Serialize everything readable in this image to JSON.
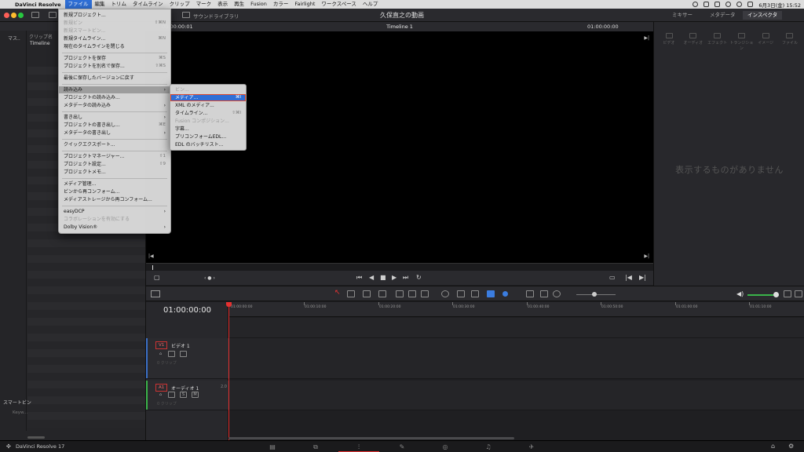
{
  "menubar": {
    "app_name": "DaVinci Resolve",
    "menus": [
      "ファイル",
      "編集",
      "トリム",
      "タイムライン",
      "クリップ",
      "マーク",
      "表示",
      "再生",
      "Fusion",
      "カラー",
      "Fairlight",
      "ワークスペース",
      "ヘルプ"
    ],
    "active_menu": "ファイル",
    "clock": "6月3日(金)  15:52"
  },
  "header": {
    "project_title": "久保直之の動画",
    "sound_library": "サウンドライブラリ",
    "right_tabs": [
      "ミキサー",
      "メタデータ",
      "インスペクタ"
    ],
    "active_right_tab": "インスペクタ"
  },
  "media_pool": {
    "master_label": "マス..",
    "clip_label": "クリップ名",
    "timeline_item": "Timeline",
    "smart_bins": "スマートビン",
    "keywords": "Keyw..."
  },
  "viewer": {
    "timecode_left": "00:00:00:01",
    "timeline_name": "Timeline 1",
    "timecode_right": "01:00:00:00"
  },
  "inspector": {
    "tabs": [
      "ビデオ",
      "オーディオ",
      "エフェクト",
      "トランジション",
      "イメージ",
      "ファイル"
    ],
    "empty_message": "表示するものがありません"
  },
  "timeline": {
    "current_timecode": "01:00:00:00",
    "ruler_ticks": [
      "01:00:00:00",
      "01:00:10:00",
      "01:00:20:00",
      "01:00:30:00",
      "01:00:40:00",
      "01:00:50:00",
      "01:01:00:00",
      "01:01:10:00"
    ],
    "tracks": [
      {
        "id": "V1",
        "name": "ビデオ 1",
        "info": "0 クリップ",
        "kind": "video"
      },
      {
        "id": "A1",
        "name": "オーディオ 1",
        "info": "0 クリップ",
        "volume": "2.0",
        "kind": "audio"
      }
    ]
  },
  "file_menu": {
    "items": [
      {
        "label": "新規プロジェクト...",
        "shortcut": "",
        "disabled": false
      },
      {
        "label": "新規ビン",
        "shortcut": "⇧⌘N",
        "disabled": true
      },
      {
        "label": "新規スマートビン...",
        "shortcut": "",
        "disabled": true
      },
      {
        "label": "新規タイムライン...",
        "shortcut": "⌘N",
        "disabled": false
      },
      {
        "label": "現在のタイムラインを閉じる",
        "shortcut": "",
        "disabled": false
      },
      {
        "label": "プロジェクトを保存",
        "shortcut": "⌘S",
        "disabled": false
      },
      {
        "label": "プロジェクトを別名で保存...",
        "shortcut": "⇧⌘S",
        "disabled": false
      },
      {
        "label": "最後に保存したバージョンに戻す",
        "shortcut": "",
        "disabled": false
      },
      {
        "label": "読み込み",
        "shortcut": "",
        "submenu": true,
        "hover": true
      },
      {
        "label": "プロジェクトの読み込み...",
        "shortcut": "",
        "disabled": false
      },
      {
        "label": "メタデータの読み込み",
        "shortcut": "",
        "submenu": true
      },
      {
        "label": "書き出し",
        "shortcut": "",
        "submenu": true
      },
      {
        "label": "プロジェクトの書き出し...",
        "shortcut": "⌘E",
        "disabled": false
      },
      {
        "label": "メタデータの書き出し",
        "shortcut": "",
        "submenu": true
      },
      {
        "label": "クイックエクスポート...",
        "shortcut": "",
        "disabled": false
      },
      {
        "label": "プロジェクトマネージャー...",
        "shortcut": "⇧1",
        "disabled": false
      },
      {
        "label": "プロジェクト設定...",
        "shortcut": "⇧9",
        "disabled": false
      },
      {
        "label": "プロジェクトメモ...",
        "shortcut": "",
        "disabled": false
      },
      {
        "label": "メディア管理...",
        "shortcut": "",
        "disabled": false
      },
      {
        "label": "ビンから再コンフォーム...",
        "shortcut": "",
        "disabled": false
      },
      {
        "label": "メディアストレージから再コンフォーム...",
        "shortcut": "",
        "disabled": false
      },
      {
        "label": "easyDCP",
        "shortcut": "",
        "submenu": true
      },
      {
        "label": "コラボレーションを有効にする",
        "shortcut": "",
        "disabled": true
      },
      {
        "label": "Dolby Vision®",
        "shortcut": "",
        "submenu": true
      }
    ]
  },
  "import_submenu": {
    "items": [
      {
        "label": "ビン...",
        "shortcut": "",
        "disabled": true
      },
      {
        "label": "メディア...",
        "shortcut": "⌘I",
        "selected": true
      },
      {
        "label": "XML のメディア...",
        "shortcut": ""
      },
      {
        "label": "タイムライン...",
        "shortcut": "⇧⌘I"
      },
      {
        "label": "Fusion コンポジション...",
        "shortcut": "",
        "disabled": true
      },
      {
        "label": "字幕...",
        "shortcut": ""
      },
      {
        "label": "プリコンフォームEDL...",
        "shortcut": ""
      },
      {
        "label": "EDL のバッチリスト...",
        "shortcut": ""
      }
    ]
  },
  "pagebar": {
    "app_version": "DaVinci Resolve 17",
    "pages": [
      "メディア",
      "カット",
      "エディット",
      "Fusion",
      "カラー",
      "Fairlight",
      "デリバー"
    ],
    "active_page": "エディット"
  },
  "colors": {
    "accent_blue": "#2f6fd6",
    "playhead_red": "#e53030",
    "audio_level_green": "#3ab34a",
    "highlight_outline": "#e0492b"
  }
}
